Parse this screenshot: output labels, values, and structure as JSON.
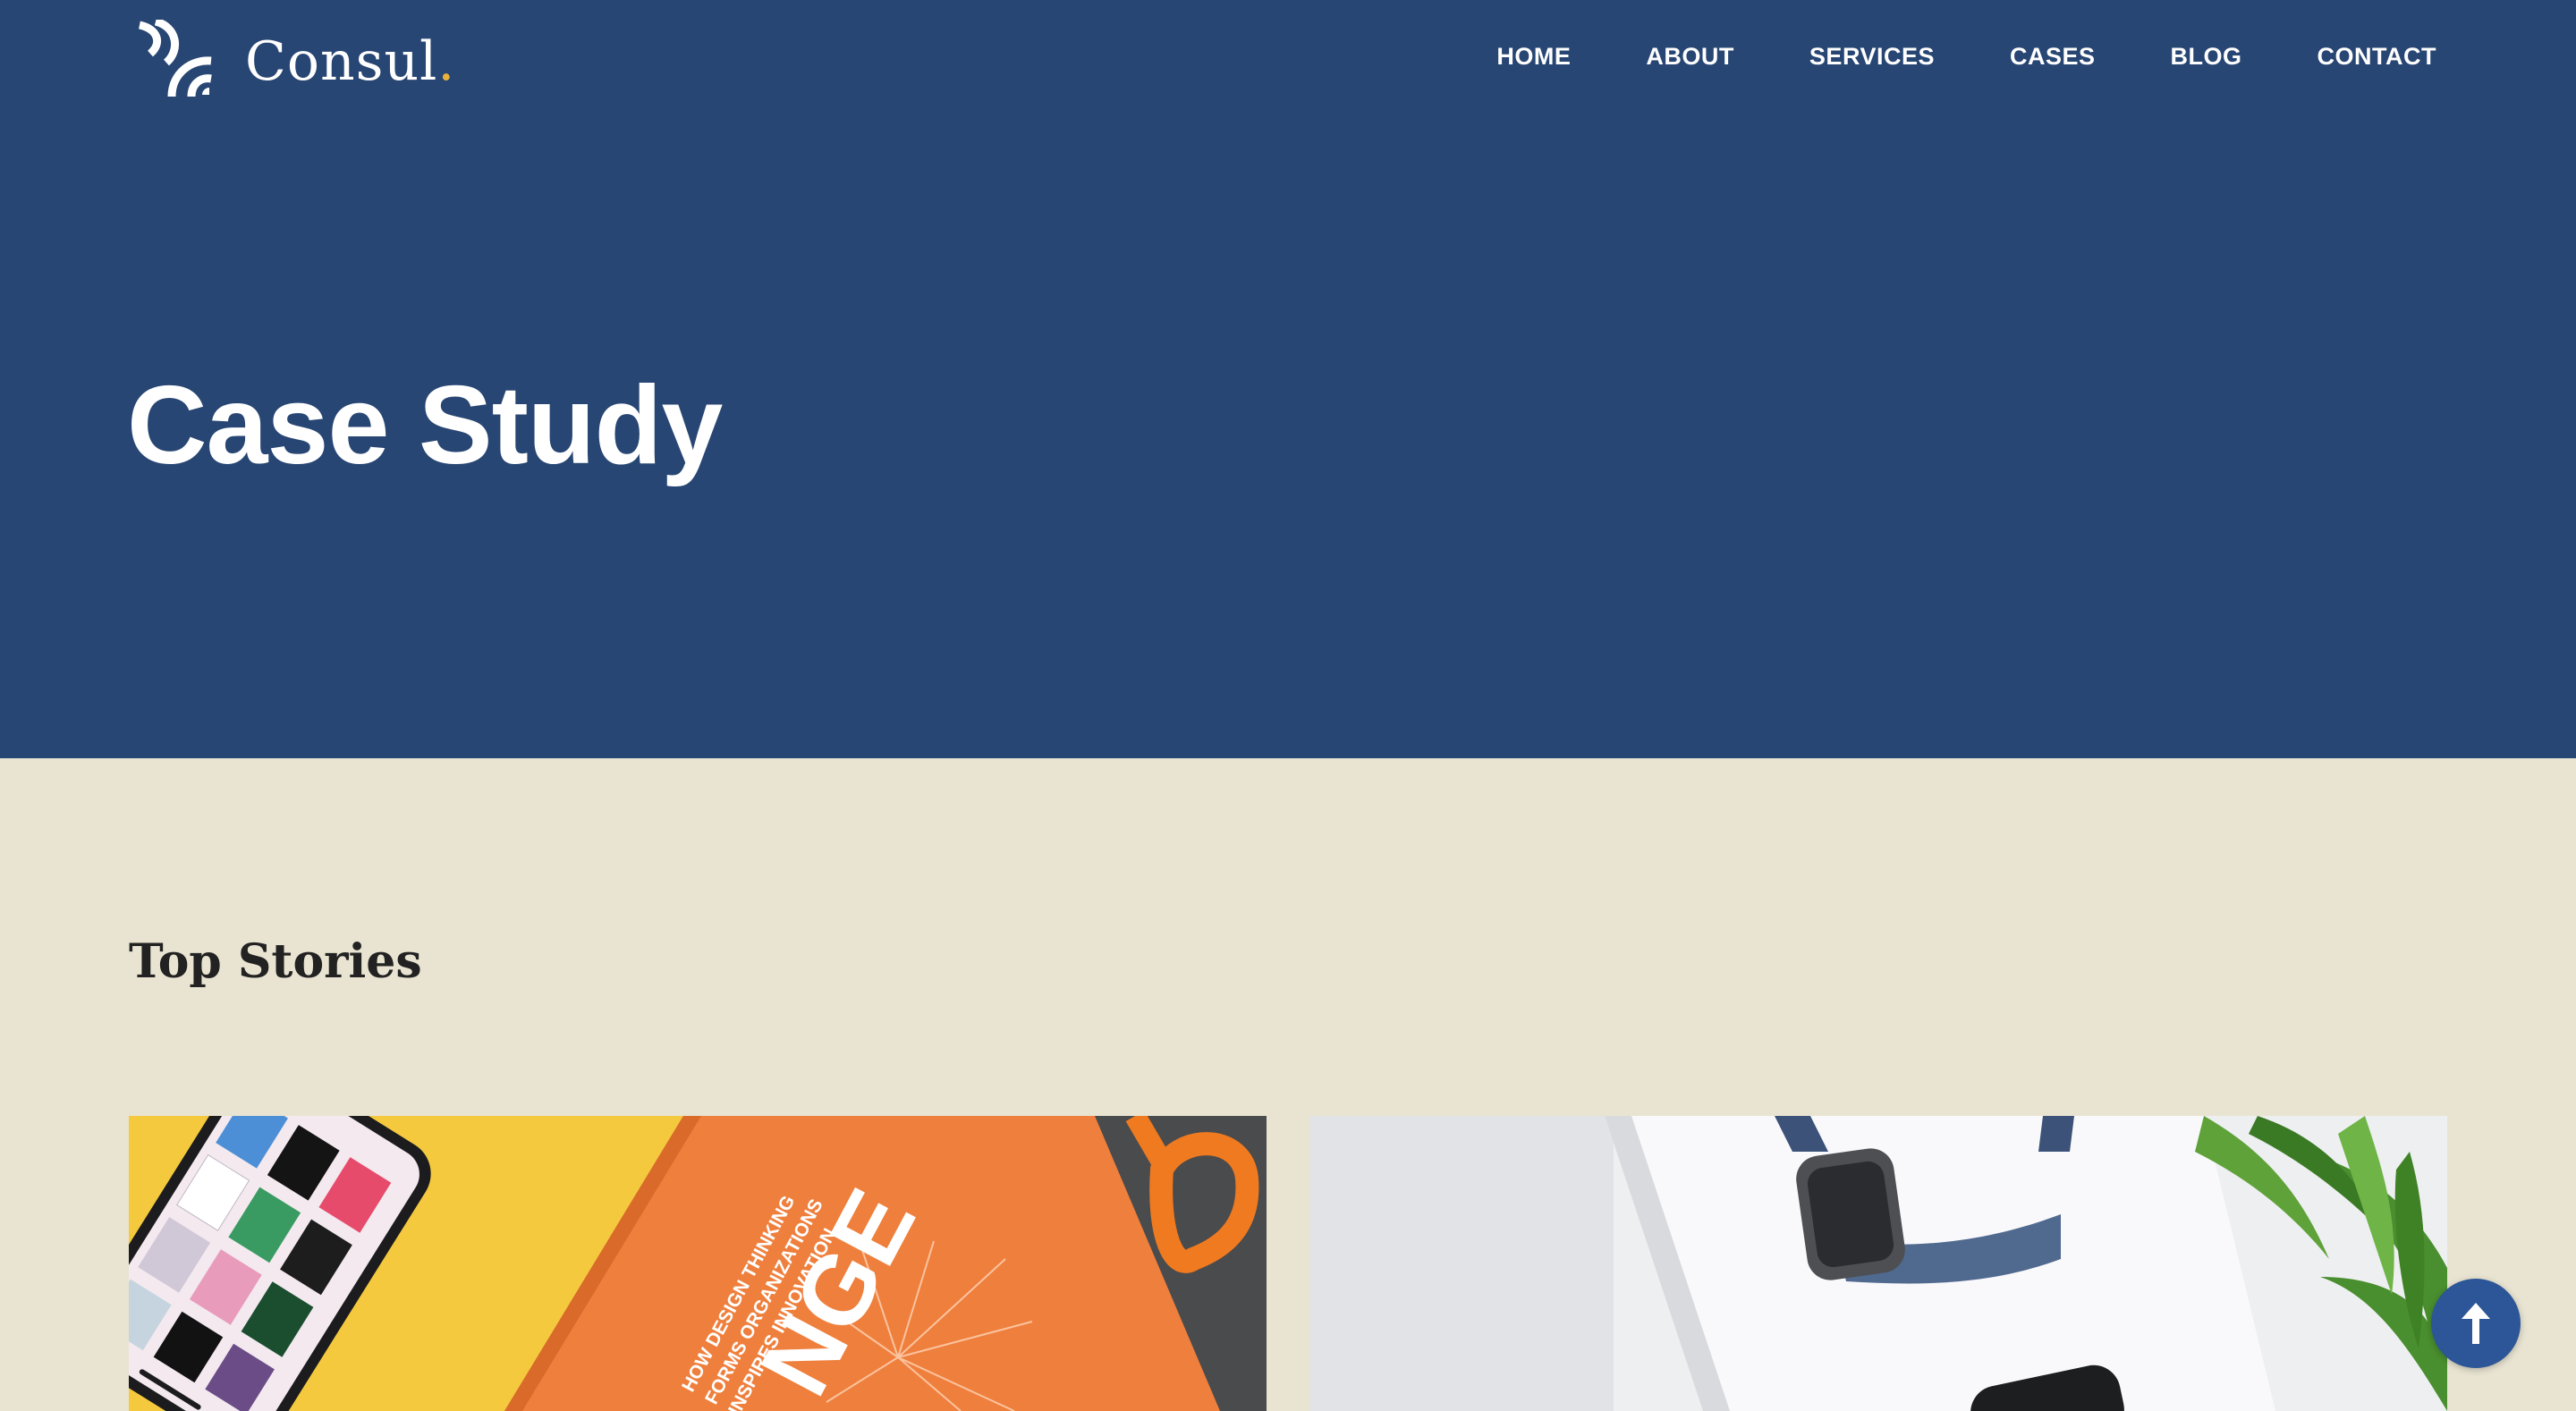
{
  "site": {
    "brand": "Consul",
    "brand_dot": "."
  },
  "nav": {
    "items": [
      {
        "label": "HOME"
      },
      {
        "label": "ABOUT"
      },
      {
        "label": "SERVICES"
      },
      {
        "label": "CASES"
      },
      {
        "label": "BLOG"
      },
      {
        "label": "CONTACT"
      }
    ]
  },
  "hero": {
    "title": "Case Study"
  },
  "main": {
    "section_title": "Top Stories",
    "cards": [
      {
        "image": "orange-design-book-with-phone-and-scissors"
      },
      {
        "image": "smartwatch-and-plant-on-white-desk"
      }
    ]
  },
  "book_cover": {
    "big_text": "NGE",
    "lines": [
      "HOW DESIGN THINKING",
      "FORMS ORGANIZATIONS",
      "INSPIRES INNOVATION"
    ]
  },
  "back_to_top": {
    "icon": "arrow-up-icon"
  },
  "colors": {
    "hero_bg": "#284673",
    "page_bg": "#e9e4d2",
    "accent": "#e8b23a",
    "back_to_top_bg": "#2c5697"
  }
}
